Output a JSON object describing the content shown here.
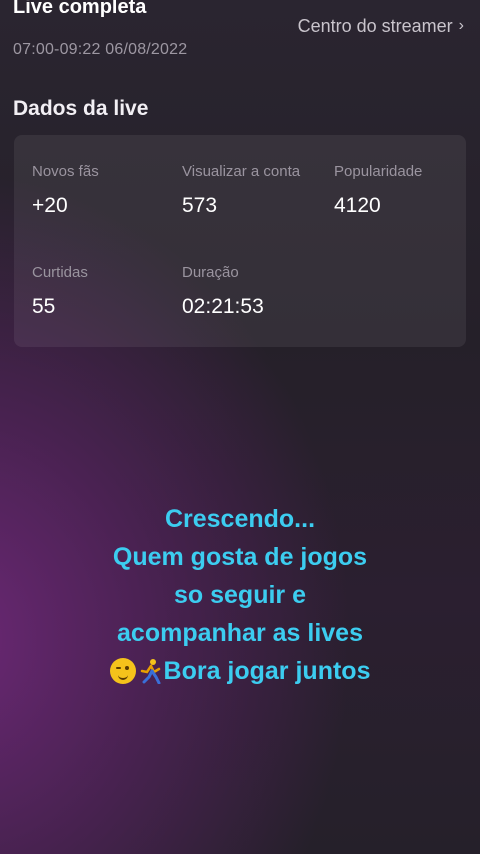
{
  "header": {
    "title": "Live completa",
    "streamer_center": "Centro do streamer",
    "time_range": "07:00-09:22 06/08/2022"
  },
  "stats": {
    "section_title": "Dados da live",
    "items": [
      {
        "label": "Novos fãs",
        "value": "+20"
      },
      {
        "label": "Visualizar a conta",
        "value": "573"
      },
      {
        "label": "Popularidade",
        "value": "4120"
      },
      {
        "label": "Curtidas",
        "value": "55"
      },
      {
        "label": "Duração",
        "value": "02:21:53"
      }
    ]
  },
  "overlay": {
    "lines": [
      "Crescendo...",
      "Quem gosta de jogos",
      "so seguir e",
      "acompanhar as lives"
    ],
    "last_line": "Bora jogar juntos",
    "emojis": [
      "winking-face-icon",
      "runner-icon"
    ],
    "text_color": "#3ccdf0"
  }
}
